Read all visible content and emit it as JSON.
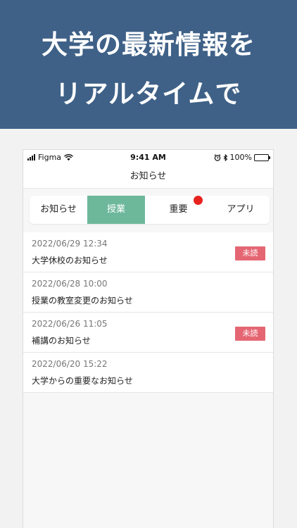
{
  "hero": {
    "line1": "大学の最新情報を",
    "line2": "リアルタイムで"
  },
  "status_bar": {
    "carrier": "Figma",
    "time": "9:41 AM",
    "battery": "100%"
  },
  "nav": {
    "title": "お知らせ"
  },
  "tabs": [
    {
      "label": "お知らせ",
      "active": false
    },
    {
      "label": "授業",
      "active": true
    },
    {
      "label": "重要",
      "active": false,
      "has_dot": true
    },
    {
      "label": "アプリ",
      "active": false
    }
  ],
  "notices": [
    {
      "date": "2022/06/29 12:34",
      "title": "大学休校のお知らせ",
      "badge": "未読"
    },
    {
      "date": "2022/06/28 10:00",
      "title": "授業の教室変更のお知らせ",
      "badge": ""
    },
    {
      "date": "2022/06/26 11:05",
      "title": "補講のお知らせ",
      "badge": "未読"
    },
    {
      "date": "2022/06/20 15:22",
      "title": "大学からの重要なお知らせ",
      "badge": ""
    }
  ],
  "colors": {
    "hero_bg": "#3f6187",
    "active_tab": "#6db89b",
    "unread_badge": "#e56673",
    "notification_dot": "#e8231f"
  }
}
